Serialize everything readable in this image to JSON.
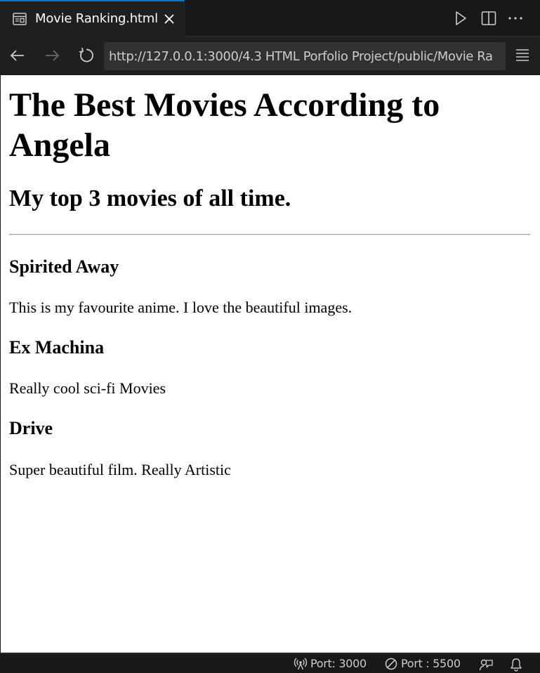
{
  "editor": {
    "tab": {
      "title": "Movie Ranking.html",
      "icon": "preview-icon",
      "close_icon": "close-icon"
    },
    "toolbar": {
      "run_icon": "run-icon",
      "split_icon": "split-editor-icon",
      "more_icon": "more-actions-icon"
    },
    "accent_color": "#0078d4"
  },
  "browser": {
    "back_icon": "arrow-left-icon",
    "forward_icon": "arrow-right-icon",
    "reload_icon": "refresh-icon",
    "url": "http://127.0.0.1:3000/4.3 HTML Porfolio Project/public/Movie Ra",
    "menu_icon": "menu-icon"
  },
  "page": {
    "heading": "The Best Movies According to Angela",
    "subheading": "My top 3 movies of all time.",
    "movies": [
      {
        "title": "Spirited Away",
        "description": "This is my favourite anime. I love the beautiful images."
      },
      {
        "title": "Ex Machina",
        "description": "Really cool sci-fi Movies"
      },
      {
        "title": "Drive",
        "description": "Super beautiful film. Really Artistic"
      }
    ]
  },
  "statusbar": {
    "port_live": "Port: 3000",
    "port_server": "Port : 5500",
    "live_icon": "broadcast-icon",
    "server_icon": "circle-slash-icon",
    "feedback_icon": "feedback-icon",
    "bell_icon": "bell-icon"
  }
}
